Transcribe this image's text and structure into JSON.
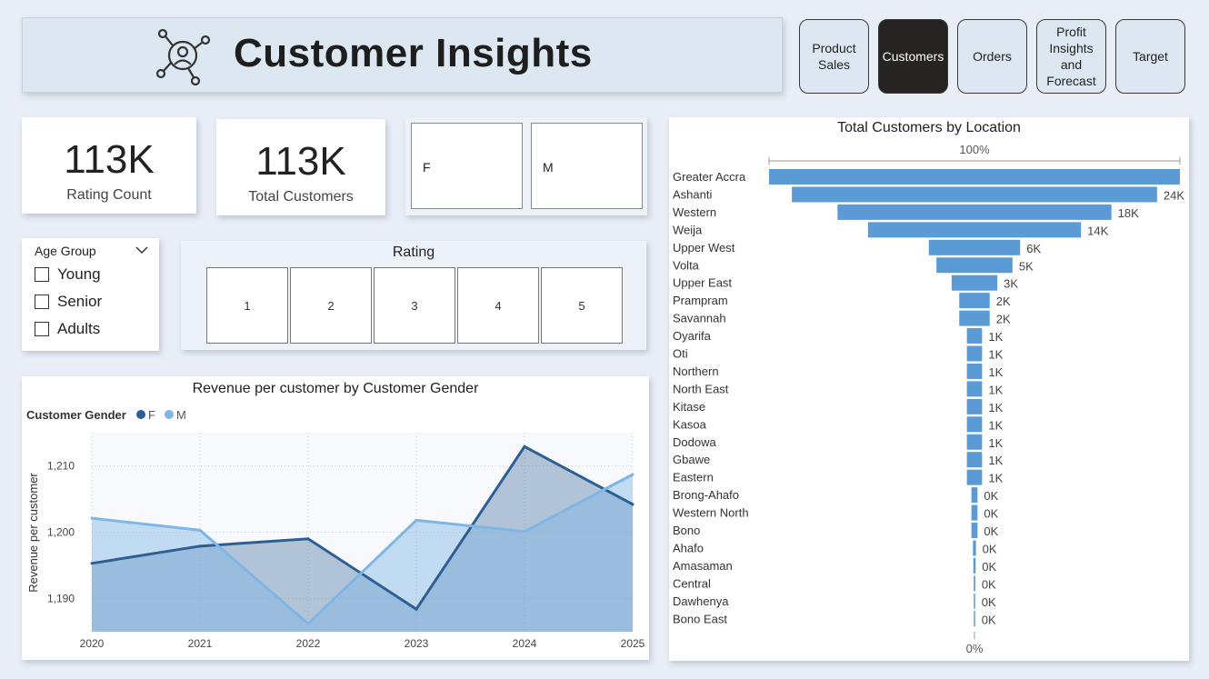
{
  "header": {
    "title": "Customer Insights",
    "logo_icon": "customer-network-icon"
  },
  "nav": [
    {
      "label": "Product Sales",
      "active": false
    },
    {
      "label": "Customers",
      "active": true
    },
    {
      "label": "Orders",
      "active": false
    },
    {
      "label": "Profit Insights and Forecast",
      "active": false
    },
    {
      "label": "Target",
      "active": false
    }
  ],
  "kpis": {
    "rating_count": {
      "value": "113K",
      "label": "Rating Count"
    },
    "total_customers": {
      "value": "113K",
      "label": "Total Customers"
    }
  },
  "gender_slicer": {
    "options": [
      "F",
      "M"
    ]
  },
  "age_slicer": {
    "title": "Age Group",
    "options": [
      "Young",
      "Senior",
      "Adults"
    ]
  },
  "rating_slicer": {
    "title": "Rating",
    "options": [
      "1",
      "2",
      "3",
      "4",
      "5"
    ]
  },
  "colors": {
    "female": "#2d5f92",
    "male": "#7fb6e6",
    "bar": "#5b9bd5",
    "nav_active": "#252423"
  },
  "chart_data": [
    {
      "type": "area",
      "title": "Revenue per customer by Customer Gender",
      "legend_title": "Customer Gender",
      "legend_position": "top-left",
      "ylabel": "Revenue per customer",
      "xlabel": "",
      "categories": [
        "2020",
        "2021",
        "2022",
        "2023",
        "2024",
        "2025"
      ],
      "y_ticks": [
        "1,190",
        "1,200",
        "1,210"
      ],
      "ylim": [
        1185,
        1215
      ],
      "grid": true,
      "series": [
        {
          "name": "F",
          "values": [
            1195.3,
            1197.9,
            1199.0,
            1188.4,
            1212.9,
            1204.2
          ]
        },
        {
          "name": "M",
          "values": [
            1202.1,
            1200.3,
            1186.2,
            1201.8,
            1200.1,
            1208.7
          ]
        }
      ]
    },
    {
      "type": "bar",
      "orientation": "funnel",
      "title": "Total Customers by Location",
      "top_label": "100%",
      "bottom_label": "0%",
      "categories": [
        "Greater Accra",
        "Ashanti",
        "Western",
        "Weija",
        "Upper West",
        "Volta",
        "Upper East",
        "Prampram",
        "Savannah",
        "Oyarifa",
        "Oti",
        "Northern",
        "North East",
        "Kitase",
        "Kasoa",
        "Dodowa",
        "Gbawe",
        "Eastern",
        "Brong-Ahafo",
        "Western North",
        "Bono",
        "Ahafo",
        "Amasaman",
        "Central",
        "Dawhenya",
        "Bono East"
      ],
      "values": [
        27,
        24,
        18,
        14,
        6,
        5,
        3,
        2,
        2,
        1,
        1,
        1,
        1,
        1,
        1,
        1,
        1,
        1,
        0.4,
        0.4,
        0.4,
        0.2,
        0.15,
        0.1,
        0.08,
        0.02
      ],
      "value_labels": [
        "",
        "24K",
        "18K",
        "14K",
        "6K",
        "5K",
        "3K",
        "2K",
        "2K",
        "1K",
        "1K",
        "1K",
        "1K",
        "1K",
        "1K",
        "1K",
        "1K",
        "1K",
        "0K",
        "0K",
        "0K",
        "0K",
        "0K",
        "0K",
        "0K",
        "0K"
      ],
      "unit": "thousands"
    }
  ]
}
